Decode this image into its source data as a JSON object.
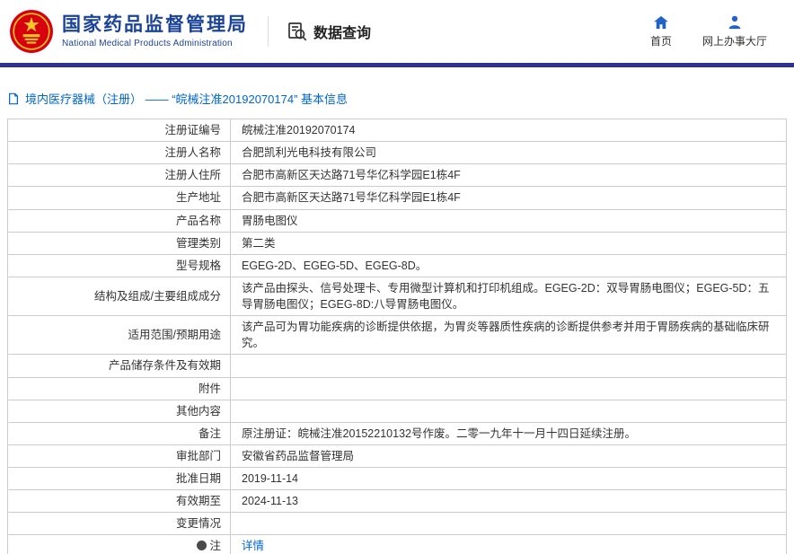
{
  "header": {
    "org_name_cn": "国家药品监督管理局",
    "org_name_en": "National Medical Products Administration",
    "nav_query_label": "数据查询",
    "home_label": "首页",
    "service_hall_label": "网上办事大厅"
  },
  "breadcrumb": {
    "text": "境内医疗器械（注册） —— “皖械注准20192070174” 基本信息"
  },
  "colors": {
    "brand_blue": "#1b4397",
    "bar_blue": "#2e3192",
    "link_blue": "#0066cc",
    "emblem_red": "#d7000f"
  },
  "table": {
    "rows": [
      {
        "label": "注册证编号",
        "value": "皖械注准20192070174"
      },
      {
        "label": "注册人名称",
        "value": "合肥凯利光电科技有限公司"
      },
      {
        "label": "注册人住所",
        "value": "合肥市高新区天达路71号华亿科学园E1栋4F"
      },
      {
        "label": "生产地址",
        "value": "合肥市高新区天达路71号华亿科学园E1栋4F"
      },
      {
        "label": "产品名称",
        "value": "胃肠电图仪"
      },
      {
        "label": "管理类别",
        "value": "第二类"
      },
      {
        "label": "型号规格",
        "value": "EGEG-2D、EGEG-5D、EGEG-8D。"
      },
      {
        "label": "结构及组成/主要组成成分",
        "value": "该产品由探头、信号处理卡、专用微型计算机和打印机组成。EGEG-2D：双导胃肠电图仪；EGEG-5D：五导胃肠电图仪；EGEG-8D:八导胃肠电图仪。"
      },
      {
        "label": "适用范围/预期用途",
        "value": "该产品可为胃功能疾病的诊断提供依据，为胃炎等器质性疾病的诊断提供参考并用于胃肠疾病的基础临床研究。"
      },
      {
        "label": "产品储存条件及有效期",
        "value": ""
      },
      {
        "label": "附件",
        "value": ""
      },
      {
        "label": "其他内容",
        "value": ""
      },
      {
        "label": "备注",
        "value": "原注册证：皖械注准20152210132号作废。二零一九年十一月十四日延续注册。"
      },
      {
        "label": "审批部门",
        "value": "安徽省药品监督管理局"
      },
      {
        "label": "批准日期",
        "value": "2019-11-14"
      },
      {
        "label": "有效期至",
        "value": "2024-11-13"
      },
      {
        "label": "变更情况",
        "value": ""
      },
      {
        "label": "注",
        "value": "详情",
        "label_icon": "note-icon",
        "value_is_link": true
      }
    ]
  }
}
